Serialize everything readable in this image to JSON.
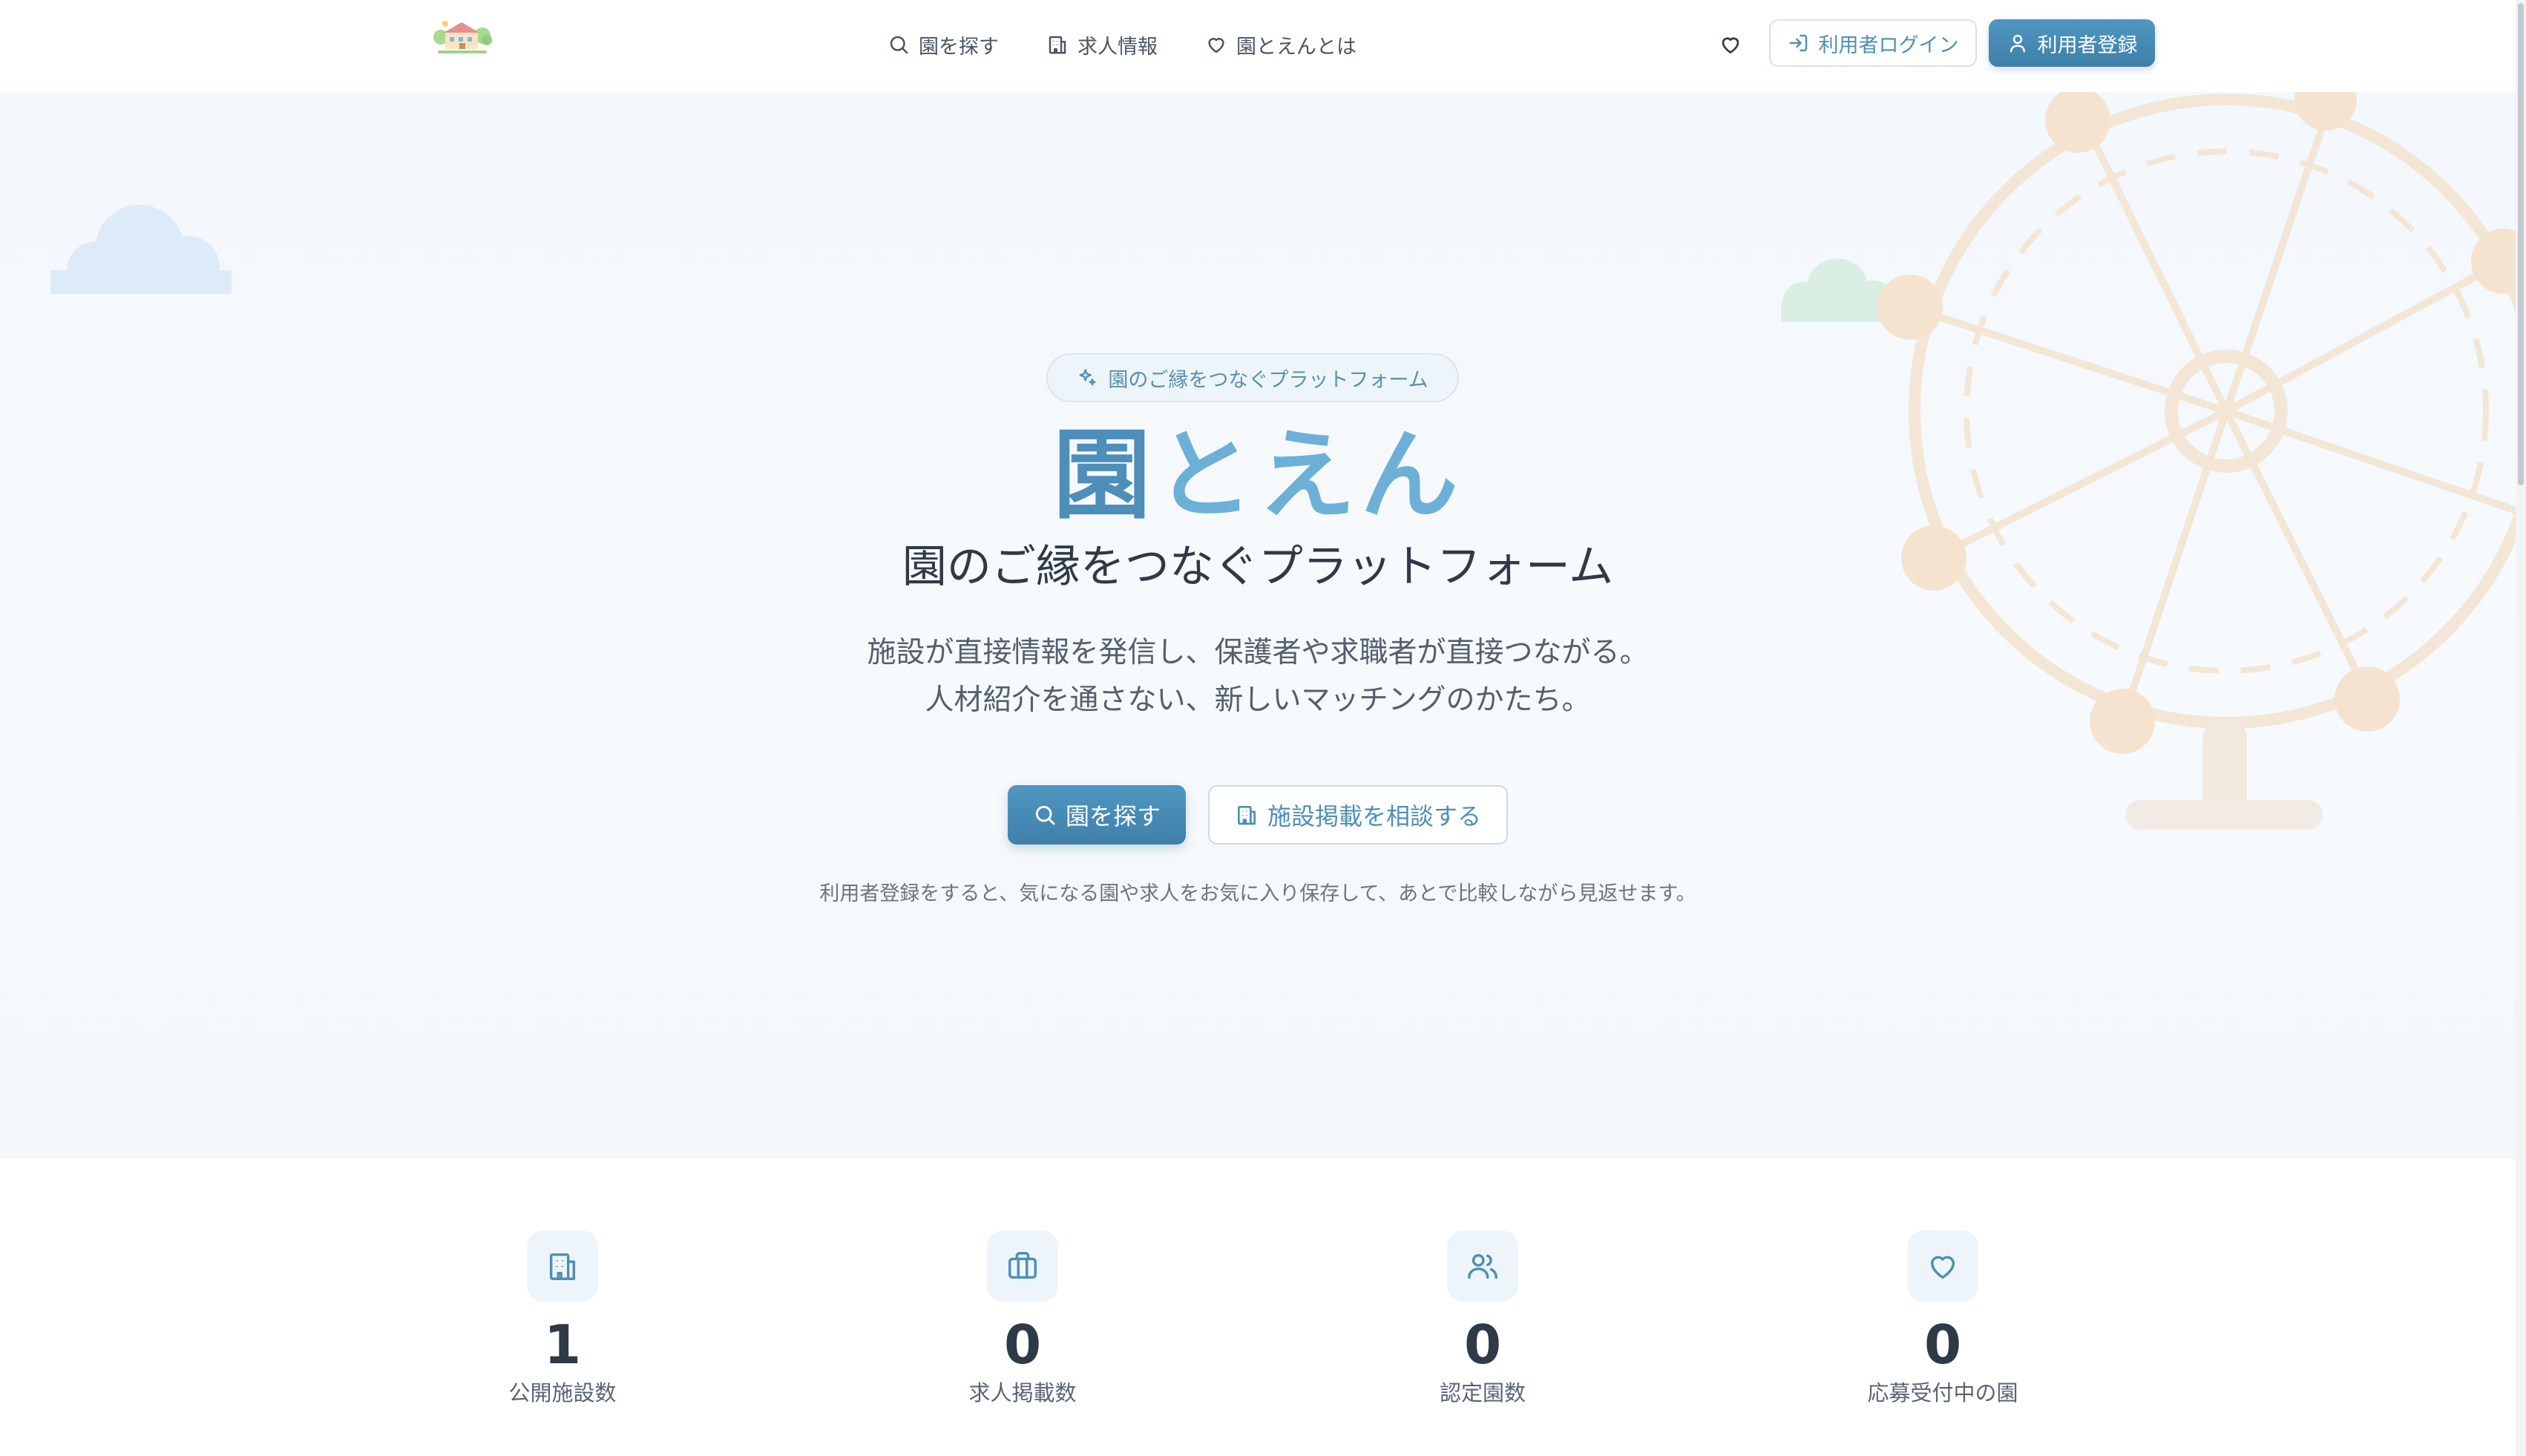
{
  "colors": {
    "accent": "#4d8fba",
    "accent_light": "#6cb0d8",
    "text_dark": "#2f3a48",
    "text_muted": "#6a7482",
    "hero_bg": "#f3f8fc",
    "wheel_deco": "#f3e2cf"
  },
  "header": {
    "logo_icon": "kindergarten-logo-icon",
    "nav": [
      {
        "label": "園を探す",
        "icon": "search-icon"
      },
      {
        "label": "求人情報",
        "icon": "building-icon"
      },
      {
        "label": "園とえんとは",
        "icon": "heart-icon"
      }
    ],
    "favorites_icon": "heart-icon",
    "login_label": "利用者ログイン",
    "register_label": "利用者登録"
  },
  "hero": {
    "badge": "園のご縁をつなぐプラットフォーム",
    "title_part1": "園",
    "title_part2": "とえん",
    "subtitle": "園のご縁をつなぐプラットフォーム",
    "description_line1": "施設が直接情報を発信し、保護者や求職者が直接つながる。",
    "description_line2": "人材紹介を通さない、新しいマッチングのかたち。",
    "cta_primary": "園を探す",
    "cta_secondary": "施設掲載を相談する",
    "note": "利用者登録をすると、気になる園や求人をお気に入り保存して、あとで比較しながら見返せます。"
  },
  "stats": [
    {
      "value": "1",
      "label": "公開施設数",
      "icon": "building-icon"
    },
    {
      "value": "0",
      "label": "求人掲載数",
      "icon": "briefcase-icon"
    },
    {
      "value": "0",
      "label": "認定園数",
      "icon": "users-icon"
    },
    {
      "value": "0",
      "label": "応募受付中の園",
      "icon": "heart-icon"
    }
  ]
}
